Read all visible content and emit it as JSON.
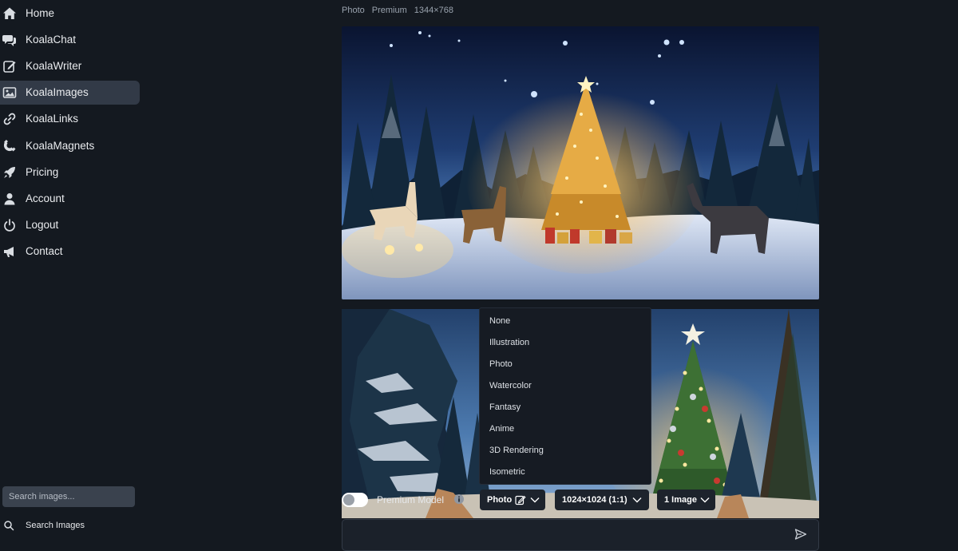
{
  "sidebar": {
    "items": [
      {
        "label": "Home",
        "icon": "home-icon"
      },
      {
        "label": "KoalaChat",
        "icon": "chat-icon"
      },
      {
        "label": "KoalaWriter",
        "icon": "edit-icon"
      },
      {
        "label": "KoalaImages",
        "icon": "image-icon",
        "active": true
      },
      {
        "label": "KoalaLinks",
        "icon": "link-icon"
      },
      {
        "label": "KoalaMagnets",
        "icon": "magnet-icon"
      },
      {
        "label": "Pricing",
        "icon": "rocket-icon"
      },
      {
        "label": "Account",
        "icon": "user-icon"
      },
      {
        "label": "Logout",
        "icon": "power-icon"
      },
      {
        "label": "Contact",
        "icon": "megaphone-icon"
      }
    ],
    "search": {
      "placeholder": "Search images...",
      "button_label": "Search Images"
    }
  },
  "image_meta": {
    "style": "Photo",
    "tier": "Premium",
    "size": "1344×768"
  },
  "style_dropdown": {
    "options": [
      "None",
      "Illustration",
      "Photo",
      "Watercolor",
      "Fantasy",
      "Anime",
      "3D Rendering",
      "Isometric"
    ]
  },
  "controls": {
    "premium_model_label": "Premium Model",
    "premium_model_enabled": false,
    "style_value": "Photo",
    "size_value": "1024×1024 (1:1)",
    "count_value": "1 Image"
  },
  "colors": {
    "background": "#141920",
    "active_nav": "#323a47",
    "accent": "#ffffff"
  }
}
